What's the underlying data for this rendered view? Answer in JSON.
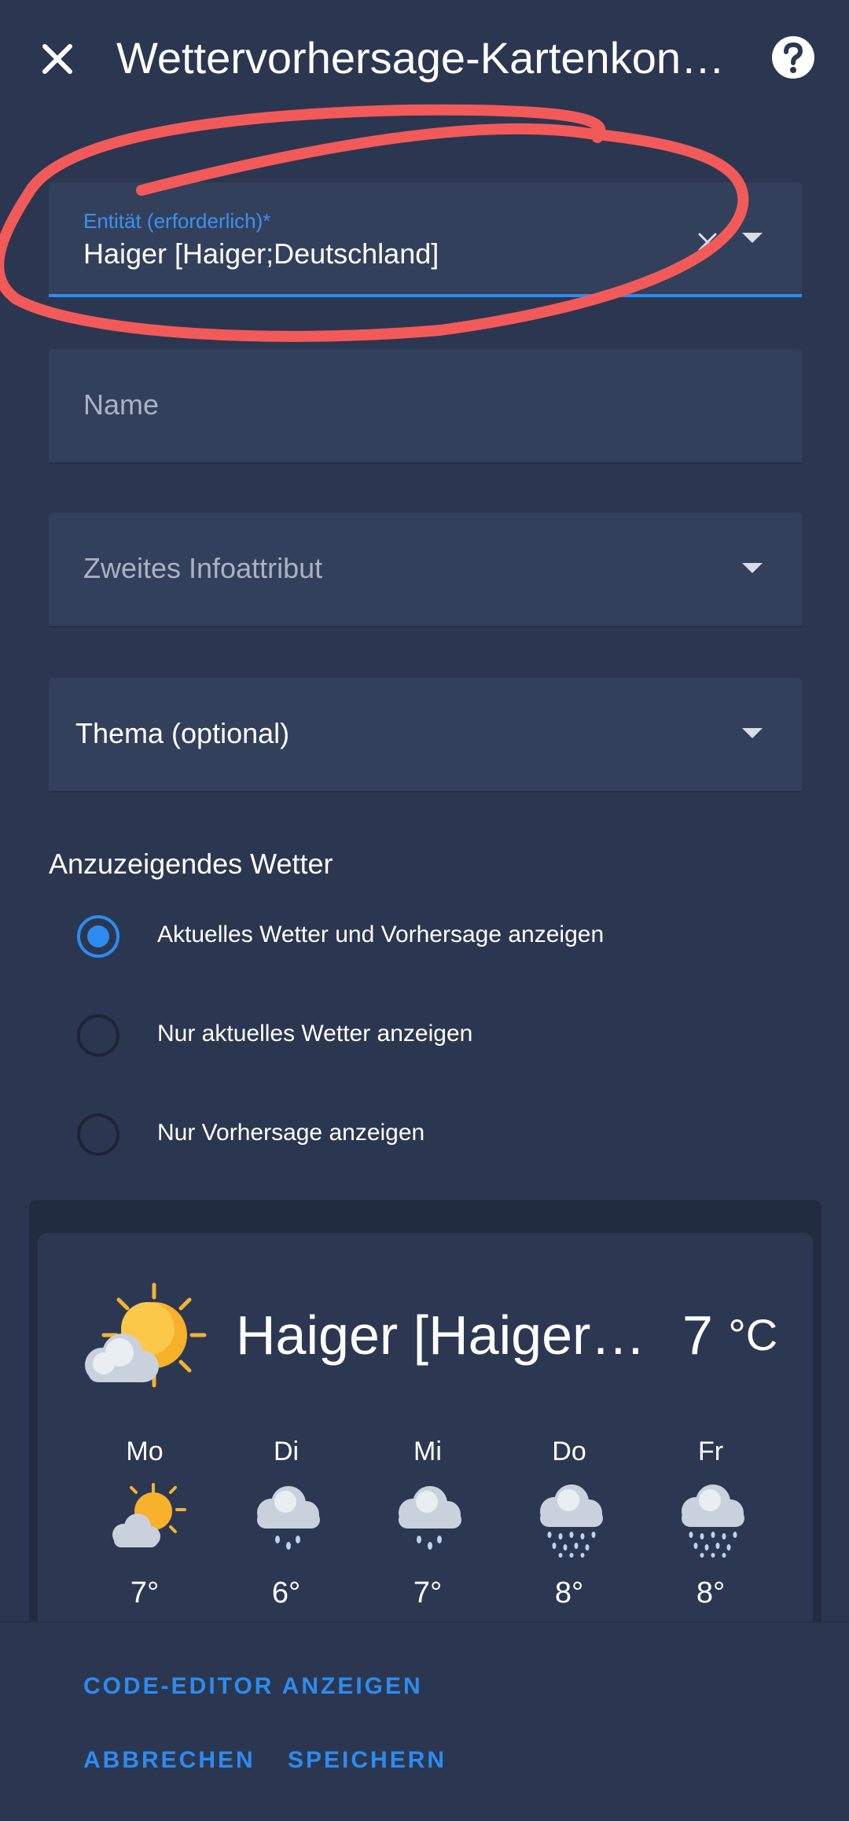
{
  "header": {
    "title": "Wettervorhersage-Kartenkon…"
  },
  "form": {
    "entity": {
      "label": "Entität (erforderlich)*",
      "value": "Haiger [Haiger;Deutschland]"
    },
    "name": {
      "placeholder": "Name"
    },
    "secondary_info": {
      "placeholder": "Zweites Infoattribut"
    },
    "theme": {
      "value": "Thema (optional)"
    }
  },
  "weather_display": {
    "title": "Anzuzeigendes Wetter",
    "options": [
      {
        "label": "Aktuelles Wetter und Vorhersage anzeigen",
        "checked": true
      },
      {
        "label": "Nur aktuelles Wetter anzeigen",
        "checked": false
      },
      {
        "label": "Nur Vorhersage anzeigen",
        "checked": false
      }
    ]
  },
  "preview": {
    "name": "Haiger [Haiger…",
    "temperature": "7",
    "unit": "°C",
    "current_icon": "partly-cloudy-icon",
    "forecast": [
      {
        "day": "Mo",
        "temp": "7°",
        "icon": "partly-cloudy-icon"
      },
      {
        "day": "Di",
        "temp": "6°",
        "icon": "rain-cloud-icon"
      },
      {
        "day": "Mi",
        "temp": "7°",
        "icon": "rain-cloud-icon"
      },
      {
        "day": "Do",
        "temp": "8°",
        "icon": "heavy-rain-cloud-icon"
      },
      {
        "day": "Fr",
        "temp": "8°",
        "icon": "heavy-rain-cloud-icon"
      }
    ]
  },
  "footer": {
    "code_editor": "CODE-EDITOR ANZEIGEN",
    "cancel": "ABBRECHEN",
    "save": "SPEICHERN"
  },
  "colors": {
    "background": "#2b3750",
    "field": "#33405b",
    "accent": "#2d8bf0",
    "annotation": "#f25a5a"
  }
}
